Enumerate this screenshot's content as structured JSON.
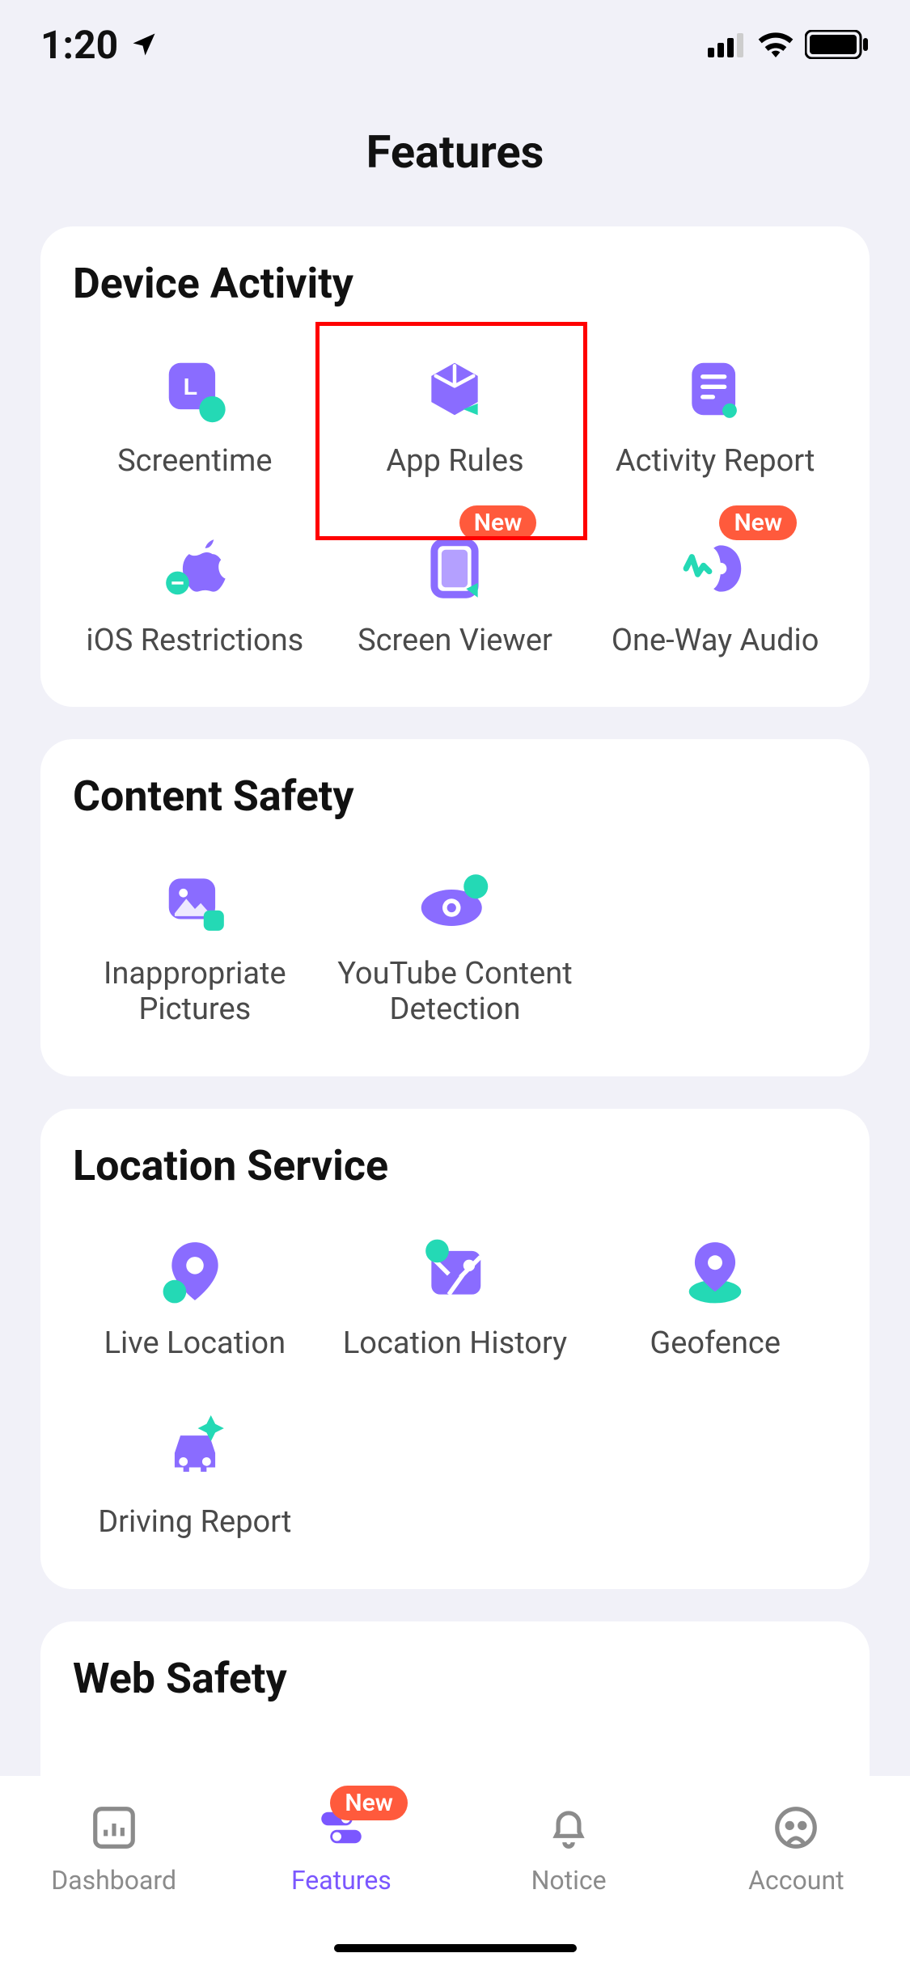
{
  "status": {
    "time": "1:20"
  },
  "page": {
    "title": "Features"
  },
  "badges": {
    "new": "New"
  },
  "sections": {
    "device": {
      "title": "Device Activity"
    },
    "content": {
      "title": "Content Safety"
    },
    "location": {
      "title": "Location Service"
    },
    "web": {
      "title": "Web Safety"
    }
  },
  "features": {
    "screentime": "Screentime",
    "app_rules": "App Rules",
    "activity_report": "Activity Report",
    "ios_restrictions": "iOS Restrictions",
    "screen_viewer": "Screen Viewer",
    "one_way_audio": "One-Way Audio",
    "inappropriate_pictures": "Inappropriate Pictures",
    "youtube_detection": "YouTube Content Detection",
    "live_location": "Live Location",
    "location_history": "Location History",
    "geofence": "Geofence",
    "driving_report": "Driving Report"
  },
  "tabs": {
    "dashboard": "Dashboard",
    "features": "Features",
    "notice": "Notice",
    "account": "Account"
  },
  "colors": {
    "brand_purple": "#7b57ff",
    "accent_teal": "#24d9b5",
    "badge_red": "#ff5a3c"
  }
}
